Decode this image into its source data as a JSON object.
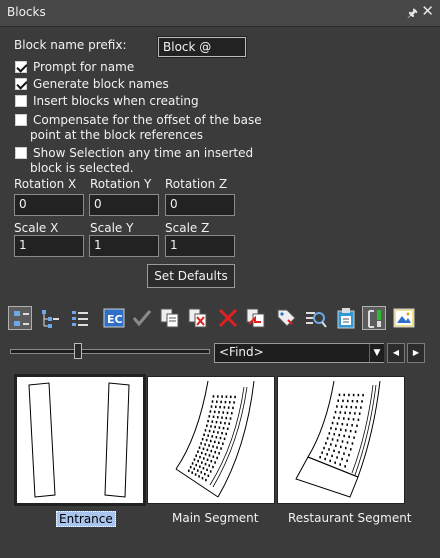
{
  "panel": {
    "title": "Blocks",
    "pin_icon": "pin-icon",
    "close_icon": "close-icon"
  },
  "form": {
    "prefix_label": "Block name prefix:",
    "prefix_value": "Block @",
    "checkboxes": [
      {
        "label": "Prompt for name",
        "checked": true
      },
      {
        "label": "Generate block names",
        "checked": true
      },
      {
        "label": "Insert blocks when creating",
        "checked": false
      },
      {
        "label_line1": "Compensate for the offset of the base",
        "label_line2": "point at the block references",
        "checked": false
      },
      {
        "label_line1": "Show Selection any time an inserted",
        "label_line2": "block is selected.",
        "checked": false
      }
    ],
    "rotation_x_label": "Rotation X",
    "rotation_y_label": "Rotation Y",
    "rotation_z_label": "Rotation Z",
    "rotation_x": "0",
    "rotation_y": "0",
    "rotation_z": "0",
    "scale_x_label": "Scale X",
    "scale_y_label": "Scale Y",
    "scale_z_label": "Scale Z",
    "scale_x": "1",
    "scale_y": "1",
    "scale_z": "1",
    "set_defaults_label": "Set Defaults"
  },
  "toolbar": {
    "icons": [
      "view-large-icon",
      "view-tree-icon",
      "view-list-icon",
      "edit-block-icon",
      "checkmark-icon",
      "copy-block-icon",
      "delete-copy-icon",
      "delete-icon",
      "replace-icon",
      "tag-icon",
      "find-icon",
      "clipboard-icon",
      "insert-icon",
      "image-icon"
    ]
  },
  "find": {
    "value": "<Find>"
  },
  "blocks": [
    {
      "name": "Entrance",
      "selected": true
    },
    {
      "name": "Main Segment",
      "selected": false
    },
    {
      "name": "Restaurant Segment",
      "selected": false
    }
  ],
  "colors": {
    "background": "#3b3b3b",
    "selection": "#a9c5ee",
    "delete_red": "#e02020"
  }
}
